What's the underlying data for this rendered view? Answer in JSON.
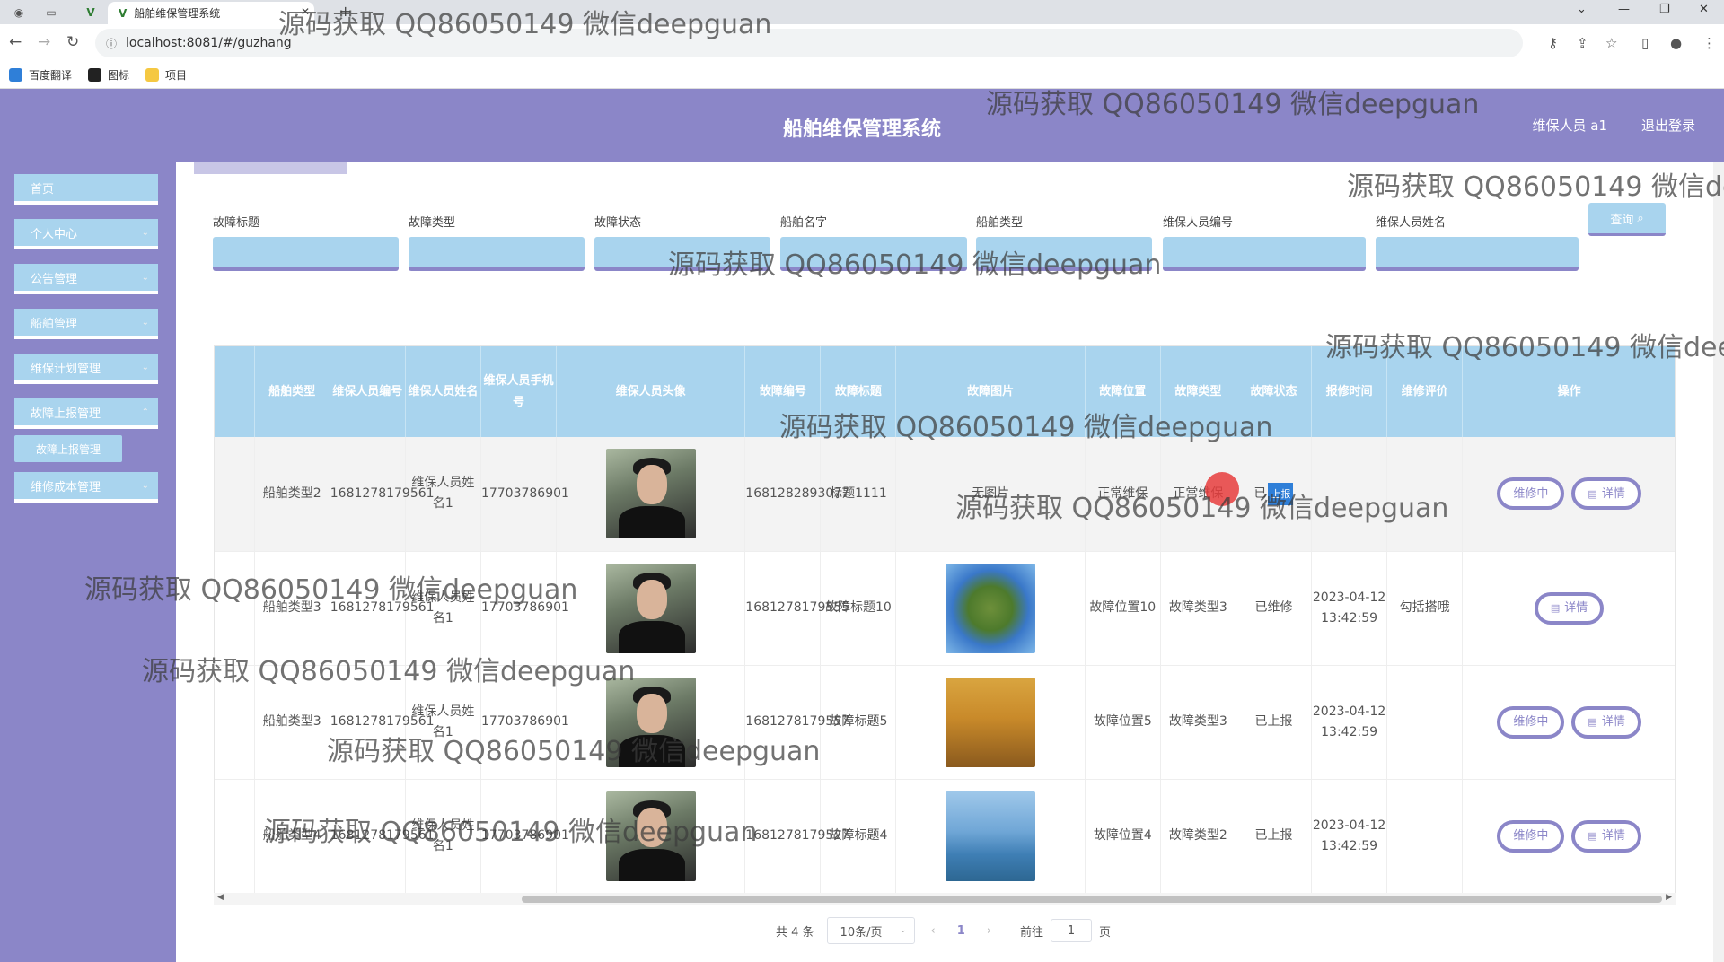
{
  "browser": {
    "tab_title": "船舶维保管理系统",
    "url": "localhost:8081/#/guzhang",
    "bookmarks": [
      "百度翻译",
      "图标",
      "项目"
    ]
  },
  "header": {
    "title": "船舶维保管理系统",
    "user": "维保人员 a1",
    "logout": "退出登录"
  },
  "sidebar": {
    "items": [
      {
        "label": "首页"
      },
      {
        "label": "个人中心"
      },
      {
        "label": "公告管理"
      },
      {
        "label": "船舶管理"
      },
      {
        "label": "维保计划管理"
      },
      {
        "label": "故障上报管理"
      },
      {
        "label": "维修成本管理"
      }
    ],
    "sub_item": "故障上报管理"
  },
  "filters": {
    "labels": [
      "故障标题",
      "故障类型",
      "故障状态",
      "船舶名字",
      "船舶类型",
      "维保人员编号",
      "维保人员姓名"
    ],
    "search_button": "查询"
  },
  "table": {
    "headers": [
      "船舶类型",
      "维保人员编号",
      "维保人员姓名",
      "维保人员手机号",
      "维保人员头像",
      "故障编号",
      "故障标题",
      "故障图片",
      "故障位置",
      "故障类型",
      "故障状态",
      "报修时间",
      "维修评价",
      "操作"
    ],
    "rows": [
      {
        "ship_type": "船舶类型2",
        "staff_no": "1681278179561",
        "staff_name": "维保人员姓名1",
        "phone": "17703786901",
        "fault_no": "1681282893077",
        "fault_title": "标题1111",
        "fault_image": "无图片",
        "location": "正常维保",
        "fault_type": "正常维保",
        "status": "已",
        "status_tag": "上报",
        "time": "",
        "review": "",
        "ops": [
          "维修中",
          "详情"
        ]
      },
      {
        "ship_type": "船舶类型3",
        "staff_no": "1681278179561",
        "staff_name": "维保人员姓名1",
        "phone": "17703786901",
        "fault_no": "1681278179555",
        "fault_title": "故障标题10",
        "fault_image": "planet",
        "location": "故障位置10",
        "fault_type": "故障类型3",
        "status": "已维修",
        "status_tag": "",
        "time": "2023-04-12 13:42:59",
        "review": "勾括搭哦",
        "ops": [
          "详情"
        ]
      },
      {
        "ship_type": "船舶类型3",
        "staff_no": "1681278179561",
        "staff_name": "维保人员姓名1",
        "phone": "17703786901",
        "fault_no": "1681278179557",
        "fault_title": "故障标题5",
        "fault_image": "autumn",
        "location": "故障位置5",
        "fault_type": "故障类型3",
        "status": "已上报",
        "status_tag": "",
        "time": "2023-04-12 13:42:59",
        "review": "",
        "ops": [
          "维修中",
          "详情"
        ]
      },
      {
        "ship_type": "船舶类型4",
        "staff_no": "1681278179561",
        "staff_name": "维保人员姓名1",
        "phone": "17703786901",
        "fault_no": "1681278179527",
        "fault_title": "故障标题4",
        "fault_image": "lake",
        "location": "故障位置4",
        "fault_type": "故障类型2",
        "status": "已上报",
        "status_tag": "",
        "time": "2023-04-12 13:42:59",
        "review": "",
        "ops": [
          "维修中",
          "详情"
        ]
      }
    ]
  },
  "pagination": {
    "total": "共 4 条",
    "page_size": "10条/页",
    "current": "1",
    "goto_prefix": "前往",
    "goto_value": "1",
    "goto_suffix": "页"
  },
  "watermark": "源码获取 QQ86050149 微信deepguan",
  "colors": {
    "accent": "#8b86c8",
    "light_blue": "#a9d4ee",
    "status_blue": "#2f7fd8"
  }
}
